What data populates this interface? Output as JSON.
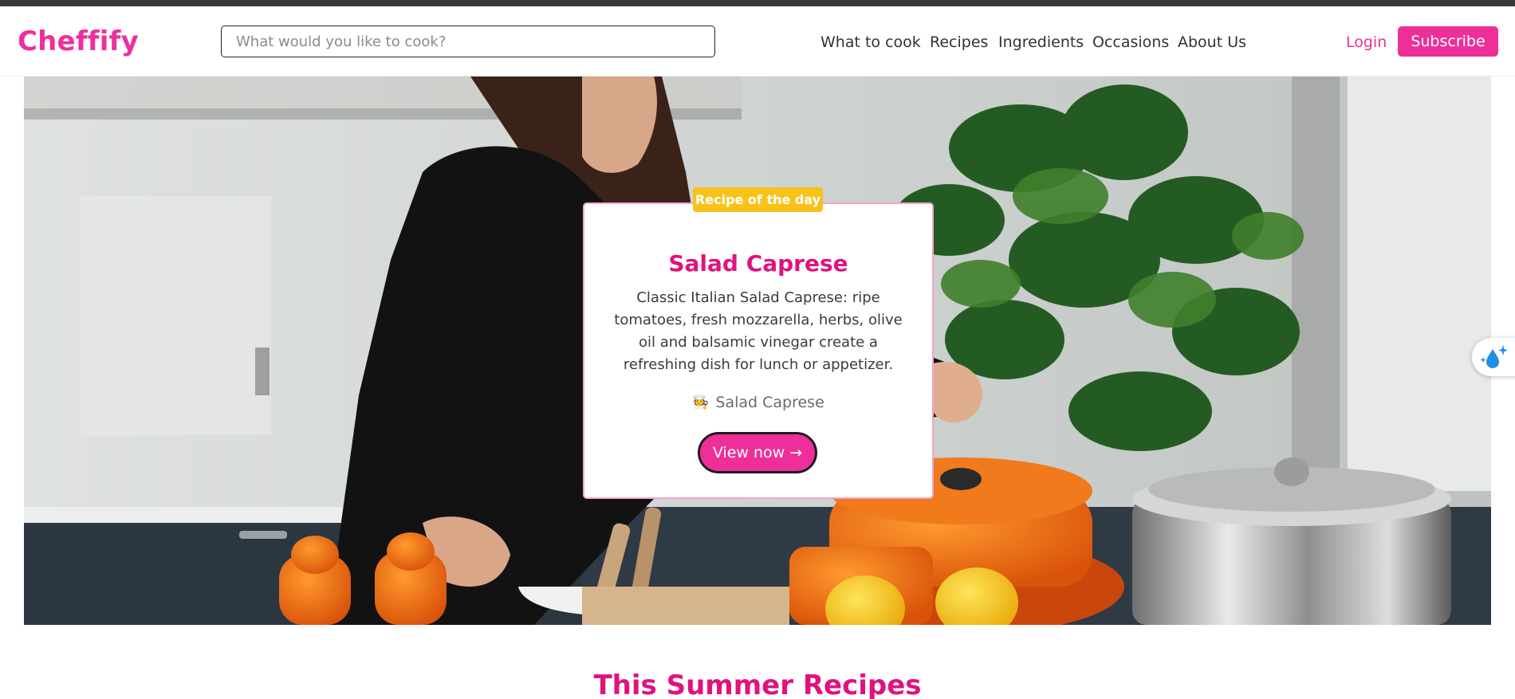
{
  "brand": {
    "name": "Cheffify",
    "accent": "#ee2f9a"
  },
  "search": {
    "placeholder": "What would you like to cook?",
    "value": ""
  },
  "nav": {
    "items": [
      {
        "label": "What to cook"
      },
      {
        "label": "Recipes"
      },
      {
        "label": "Ingredients"
      },
      {
        "label": "Occasions"
      },
      {
        "label": "About Us"
      }
    ]
  },
  "auth": {
    "login_label": "Login",
    "subscribe_label": "Subscribe"
  },
  "hero": {
    "badge": "Recipe of the day",
    "title": "Salad Caprese",
    "description": "Classic Italian Salad Caprese: ripe tomatoes, fresh mozzarella, herbs, olive oil and balsamic vinegar create a refreshing dish for lunch or appetizer.",
    "author_icon": "chef-icon",
    "author": "Salad Caprese",
    "button_label": "View now →",
    "badge_color": "#f7c31b",
    "title_color": "#e0127f"
  },
  "floating_button": {
    "icon": "water-drop-sparkle-icon"
  },
  "section": {
    "title": "This Summer Recipes"
  }
}
